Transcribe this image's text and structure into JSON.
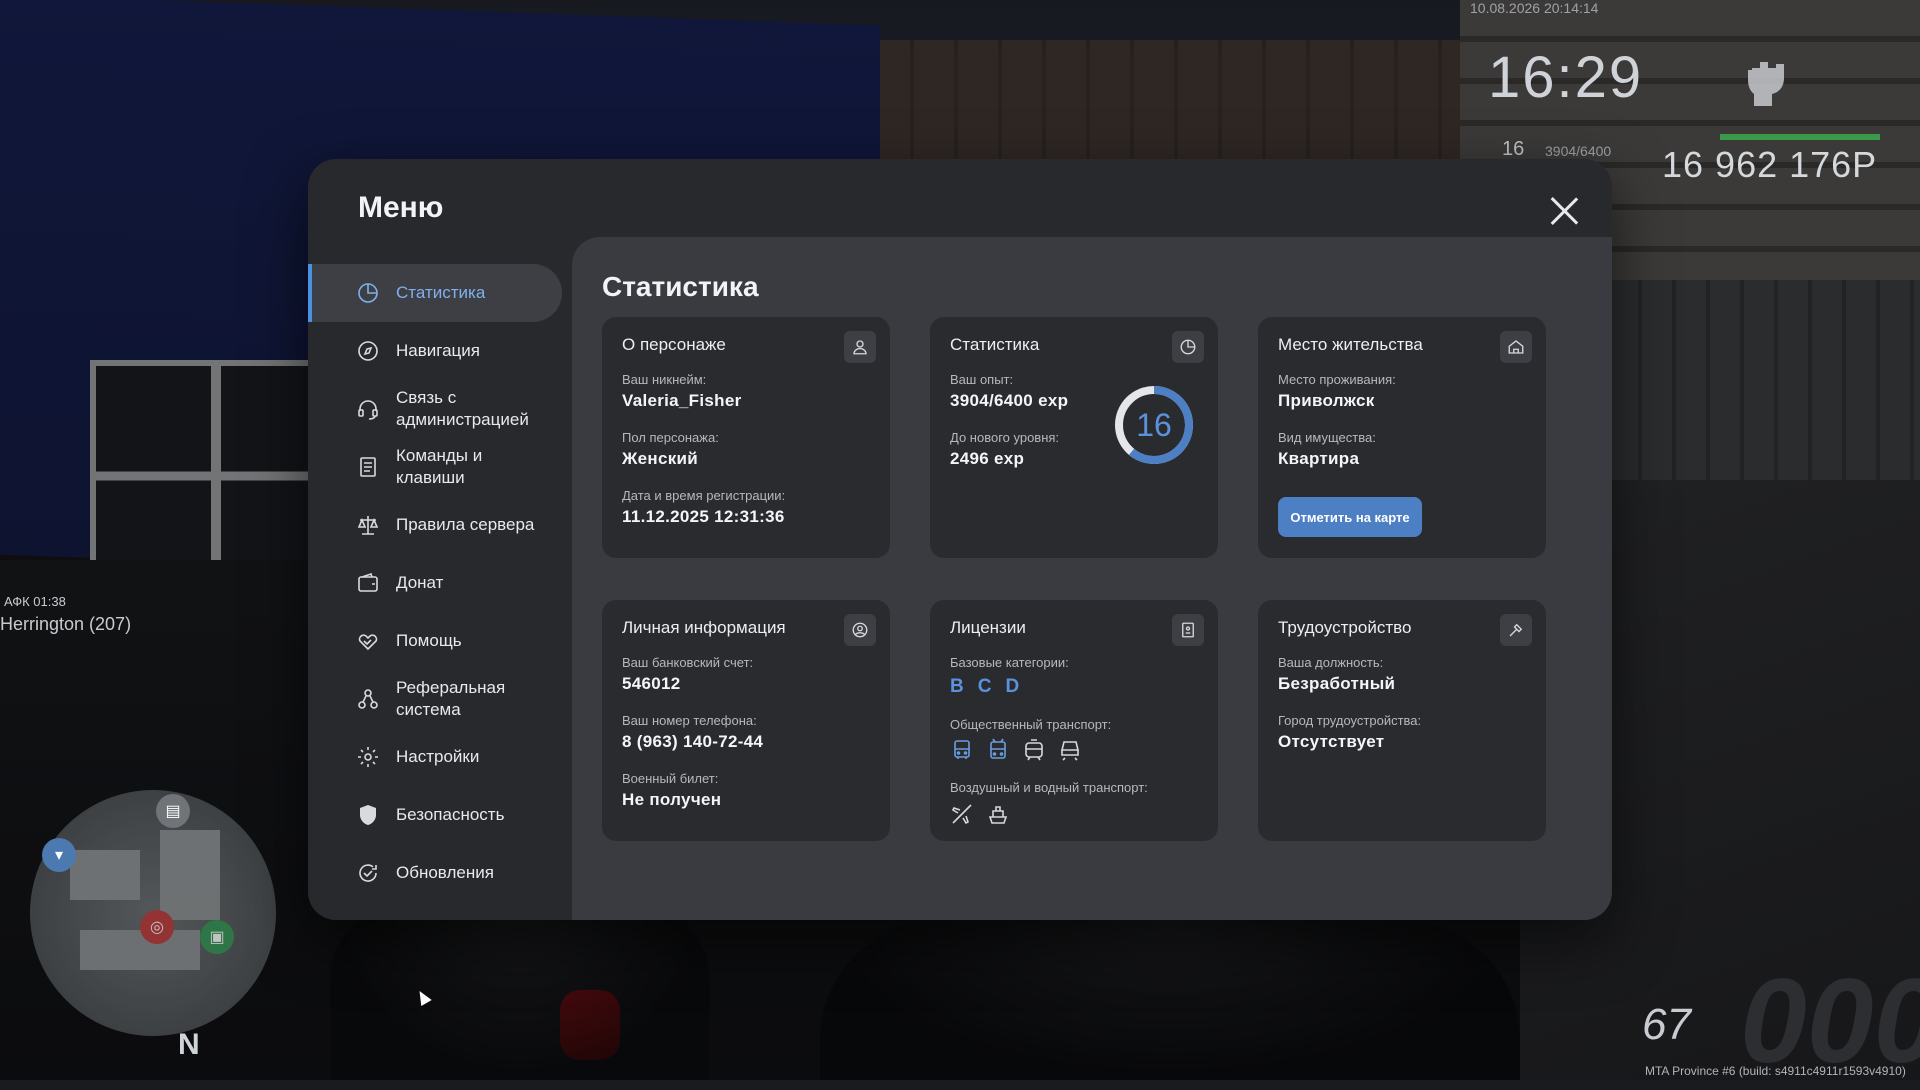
{
  "hud": {
    "datetime": "10.08.2026 20:14:14",
    "clock": "16:29",
    "level": "16",
    "exp": "3904/6400",
    "money": "16 962 176Р",
    "afk": "АФК 01:38",
    "player": "Herrington (207)",
    "speed": "67",
    "speed_big": "000",
    "north": "N",
    "build": "MTA Province #6 (build: s4911c4911r1593v4910)"
  },
  "modal": {
    "title": "Меню",
    "content_title": "Статистика"
  },
  "sidebar": {
    "items": [
      {
        "label": "Статистика",
        "icon": "pie-chart-icon",
        "active": true
      },
      {
        "label": "Навигация",
        "icon": "compass-icon"
      },
      {
        "label": "Связь с администрацией",
        "icon": "headset-icon"
      },
      {
        "label": "Команды и клавиши",
        "icon": "document-list-icon"
      },
      {
        "label": "Правила сервера",
        "icon": "scales-icon"
      },
      {
        "label": "Донат",
        "icon": "wallet-icon"
      },
      {
        "label": "Помощь",
        "icon": "helping-hand-icon"
      },
      {
        "label": "Реферальная система",
        "icon": "referral-icon"
      },
      {
        "label": "Настройки",
        "icon": "gear-icon"
      },
      {
        "label": "Безопасность",
        "icon": "shield-icon"
      },
      {
        "label": "Обновления",
        "icon": "refresh-check-icon"
      }
    ]
  },
  "cards": {
    "character": {
      "title": "О персонаже",
      "nickname_label": "Ваш никнейм:",
      "nickname": "Valeria_Fisher",
      "gender_label": "Пол персонажа:",
      "gender": "Женский",
      "reg_label": "Дата и время регистрации:",
      "reg": "11.12.2025 12:31:36"
    },
    "stats": {
      "title": "Статистика",
      "exp_label": "Ваш опыт:",
      "exp": "3904/6400 exp",
      "next_label": "До нового уровня:",
      "next": "2496 exp",
      "level": "16",
      "progress": 0.61,
      "accent": "#4d7fc5"
    },
    "residence": {
      "title": "Место жительства",
      "place_label": "Место проживания:",
      "place": "Приволжск",
      "property_label": "Вид имущества:",
      "property": "Квартира",
      "button": "Отметить на карте"
    },
    "personal": {
      "title": "Личная информация",
      "bank_label": "Ваш банковский счет:",
      "bank": "546012",
      "phone_label": "Ваш номер телефона:",
      "phone": "8 (963) 140-72-44",
      "military_label": "Военный билет:",
      "military": "Не получен"
    },
    "licenses": {
      "title": "Лицензии",
      "basic_label": "Базовые категории:",
      "categories": [
        "B",
        "C",
        "D"
      ],
      "public_label": "Общественный транспорт:",
      "air_label": "Воздушный и водный транспорт:"
    },
    "employment": {
      "title": "Трудоустройство",
      "position_label": "Ваша должность:",
      "position": "Безработный",
      "city_label": "Город трудоустройства:",
      "city": "Отсутствует"
    }
  }
}
